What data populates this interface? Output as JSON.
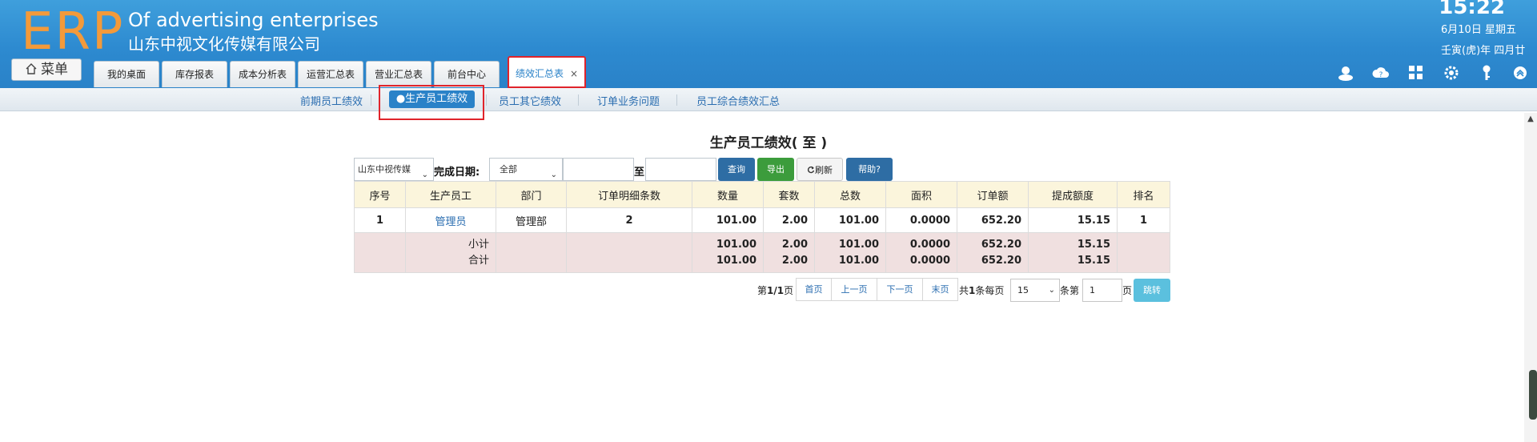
{
  "header": {
    "logo": "ERP",
    "company_en": "Of advertising enterprises",
    "company_cn": "山东中视文化传媒有限公司",
    "time": "15:22",
    "date": "6月10日 星期五",
    "lunar": "壬寅(虎)年 四月廿",
    "menu_label": "菜单"
  },
  "tabs": [
    {
      "label": "我的桌面"
    },
    {
      "label": "库存报表"
    },
    {
      "label": "成本分析表"
    },
    {
      "label": "运营汇总表"
    },
    {
      "label": "营业汇总表"
    },
    {
      "label": "前台中心"
    },
    {
      "label": "绩效汇总表",
      "active": true,
      "close": "×"
    }
  ],
  "header_icons": [
    "user-icon",
    "help-cloud-icon",
    "apps-grid-icon",
    "gear-icon",
    "key-icon",
    "collapse-up-icon"
  ],
  "subnav": {
    "items": [
      "前期员工绩效",
      "●生产员工绩效",
      "员工其它绩效",
      "订单业务问题",
      "员工综合绩效汇总"
    ],
    "active_index": 1
  },
  "main": {
    "title": "生产员工绩效( 至 )",
    "company_select": "山东中视传媒",
    "date_label": "完成日期:",
    "status_select": "全部",
    "date_start": "",
    "to_label": "至",
    "date_end": "",
    "buttons": {
      "query": "查询",
      "export": "导出",
      "refresh": "刷新",
      "help": "帮助?"
    }
  },
  "table": {
    "columns": [
      "序号",
      "生产员工",
      "部门",
      "订单明细条数",
      "数量",
      "套数",
      "总数",
      "面积",
      "订单额",
      "提成额度",
      "排名"
    ],
    "rows": [
      [
        "1",
        "管理员",
        "管理部",
        "2",
        "101.00",
        "2.00",
        "101.00",
        "0.0000",
        "652.20",
        "15.15",
        "1"
      ]
    ],
    "subtotal": {
      "label": "小计",
      "qty": "101.00",
      "sets": "2.00",
      "total": "101.00",
      "area": "0.0000",
      "amount": "652.20",
      "commission": "15.15"
    },
    "grand_total": {
      "label": "合计",
      "qty": "101.00",
      "sets": "2.00",
      "total": "101.00",
      "area": "0.0000",
      "amount": "652.20",
      "commission": "15.15"
    }
  },
  "pager": {
    "page_info_prefix": "第",
    "page_info": "1/1",
    "page_info_suffix": "页",
    "first": "首页",
    "prev": "上一页",
    "next": "下一页",
    "last": "末页",
    "total_prefix": "共",
    "total": "1",
    "total_suffix": "条每页",
    "per_page": "15",
    "goto_prefix": "条第",
    "goto_page": "1",
    "goto_suffix": "页",
    "go": "跳转"
  }
}
